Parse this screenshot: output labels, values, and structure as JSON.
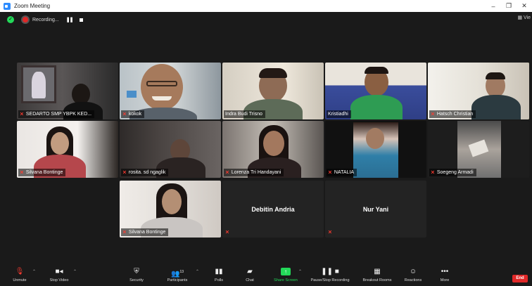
{
  "window": {
    "title": "Zoom Meeting",
    "minimize": "–",
    "restore": "❐",
    "close": "✕"
  },
  "topbar": {
    "recording_label": "Recording...",
    "pause_icon": "❚❚",
    "view_label": "▦ Vie"
  },
  "participants": [
    {
      "name": "SEDARTO SMP YBPK KED...",
      "muted": true
    },
    {
      "name": "kokok",
      "muted": true
    },
    {
      "name": "Indra Budi Trisno",
      "muted": false
    },
    {
      "name": "Kristiadhi",
      "muted": false
    },
    {
      "name": "Hatsch Christian",
      "muted": true,
      "active_speaker": true
    },
    {
      "name": "Silvana Bontinge",
      "muted": true
    },
    {
      "name": "rosita. sd ngaglik",
      "muted": true
    },
    {
      "name": "Lorenza Tri Handayani",
      "muted": true
    },
    {
      "name": "NATALIA",
      "muted": true
    },
    {
      "name": "Soegeng Armadi",
      "muted": true
    },
    {
      "name": "Silvana Bontinge",
      "muted": true
    },
    {
      "name": "Debitin Andria",
      "muted": true,
      "video_off": true
    },
    {
      "name": "Nur Yani",
      "muted": true,
      "video_off": true
    }
  ],
  "toolbar": {
    "unmute": "Unmute",
    "stop_video": "Stop Video",
    "security": "Security",
    "participants": "Participants",
    "participants_count": "13",
    "polls": "Polls",
    "chat": "Chat",
    "share_screen": "Share Screen",
    "pause_recording": "Pause/Stop Recording",
    "breakout_rooms": "Breakout Rooms",
    "reactions": "Reactions",
    "more": "More",
    "end": "End"
  },
  "colors": {
    "accent_green": "#23d959",
    "end_red": "#e02828",
    "active_border": "#d8e45a",
    "zoom_blue": "#2d8cff"
  },
  "icons": [
    "zoom-app-icon",
    "security-shield-icon",
    "recording-dot-icon",
    "muted-mic-icon",
    "microphone-icon",
    "video-camera-icon",
    "shield-icon",
    "participants-icon",
    "polls-icon",
    "chat-icon",
    "share-screen-icon",
    "record-icon",
    "breakout-rooms-icon",
    "reactions-icon",
    "more-icon"
  ]
}
